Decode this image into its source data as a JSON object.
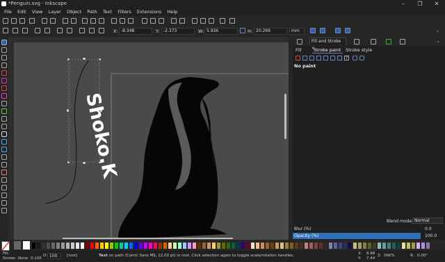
{
  "window": {
    "title": "*Penguin.svg - Inkscape"
  },
  "menu": [
    "File",
    "Edit",
    "View",
    "Layer",
    "Object",
    "Path",
    "Text",
    "Filters",
    "Extensions",
    "Help"
  ],
  "controls": {
    "x_label": "X:",
    "x_value": "-8.348",
    "y_label": "Y:",
    "y_value": "-2.373",
    "w_label": "W:",
    "w_value": "5.936",
    "h_label": "H:",
    "h_value": "20.269",
    "unit": "mm"
  },
  "canvas": {
    "text_object": "Shoko.K"
  },
  "panel": {
    "tab_label": "Fill and Stroke",
    "subtabs": [
      "Fill",
      "Stroke paint",
      "Stroke style"
    ],
    "paint_status": "No paint",
    "blend_label": "Blend mode:",
    "blend_value": "Normal",
    "blur_label": "Blur (%)",
    "blur_value": "0.0",
    "opacity_label": "Opacity (%)",
    "opacity_value": "100.0",
    "opacity_level": 1.0
  },
  "colors": {
    "accent": "#2e6fb8",
    "palette": [
      "#000000",
      "#1a1a1a",
      "#333333",
      "#4d4d4d",
      "#666666",
      "#808080",
      "#999999",
      "#b3b3b3",
      "#cccccc",
      "#e6e6e6",
      "#ffffff",
      "#800000",
      "#ff0000",
      "#ff6600",
      "#ffcc00",
      "#ffff00",
      "#99cc00",
      "#00cc00",
      "#00cc99",
      "#00ccff",
      "#0066ff",
      "#0000ff",
      "#6600ff",
      "#cc00ff",
      "#ff00cc",
      "#ff0066",
      "#993300",
      "#cc6600",
      "#ffcc99",
      "#ccff99",
      "#99ffcc",
      "#99ccff",
      "#cc99ff",
      "#ff99cc",
      "#663300",
      "#996633",
      "#cc9966",
      "#ffcc66",
      "#999933",
      "#666600",
      "#336600",
      "#006633",
      "#003366",
      "#330066",
      "#660033",
      "#ffe0c0",
      "#f0c090",
      "#d09060",
      "#a06030",
      "#704010",
      "#c0a060",
      "#e0c080",
      "#a08040",
      "#806020",
      "#604010",
      "#403020",
      "#c08080",
      "#a06060",
      "#804040",
      "#603030",
      "#402020",
      "#8080c0",
      "#6060a0",
      "#404080",
      "#203060",
      "#101040",
      "#c0c080",
      "#a0a060",
      "#808040",
      "#606020",
      "#404010",
      "#80c0c0",
      "#60a0a0",
      "#408080",
      "#206060",
      "#104040",
      "#e0e0a0",
      "#c0c060",
      "#a0a040",
      "#d0b0f0",
      "#b090d0",
      "#9070b0"
    ]
  },
  "status": {
    "fill_label": "Fill:",
    "stroke_label": "Stroke:",
    "stroke_value": "None",
    "stroke_width": "0.100",
    "opacity_label": "O:",
    "opacity_value": "100",
    "layer": "[root]",
    "message_bold": "Text",
    "message": " on path (Comic Sans MS, 12.00 pt) in root. Click selection again to toggle scale/rotation handles.",
    "cursor_x": "8.98",
    "cursor_y": "7.44",
    "zoom_label": "Z:",
    "zoom": "566%",
    "rotation_label": "R:",
    "rotation": "0.00°"
  }
}
